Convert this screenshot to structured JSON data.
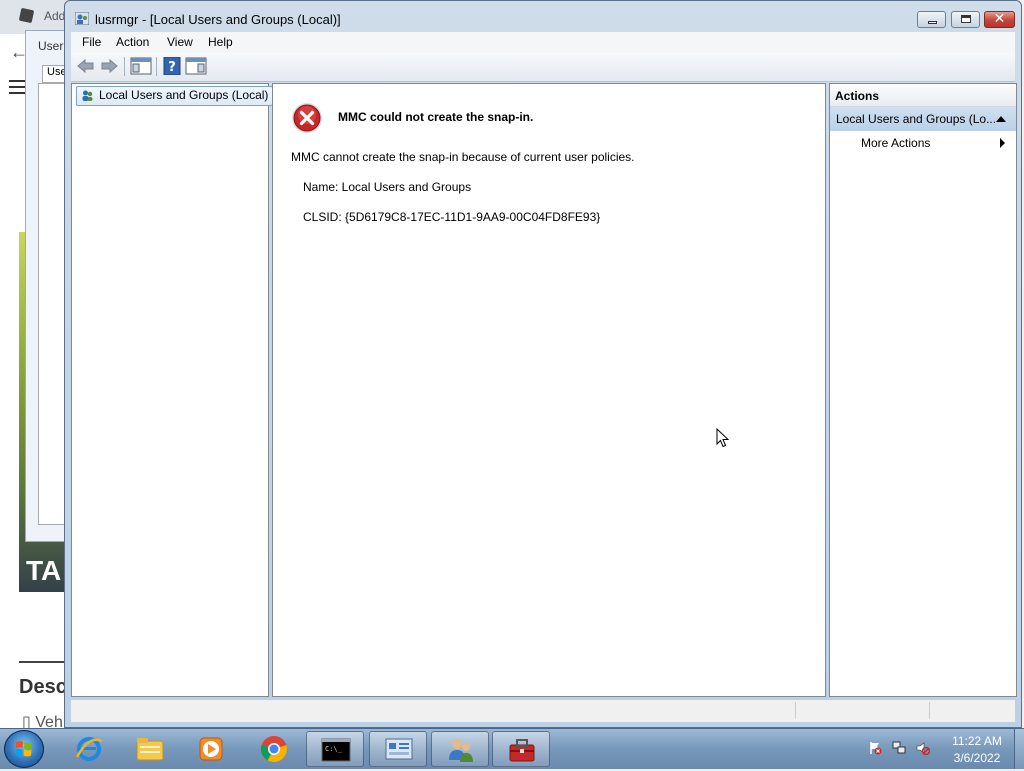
{
  "background": {
    "tab_title": "Add",
    "dialog_title": "User",
    "dialog_tab": "Use",
    "image_text": "TA",
    "heading": "Desc",
    "subtext": "▯ Veh"
  },
  "window": {
    "title": "lusrmgr - [Local Users and Groups (Local)]",
    "buttons": {
      "minimize": "minimize",
      "maximize": "restore",
      "close": "✕"
    }
  },
  "menu": [
    "File",
    "Action",
    "View",
    "Help"
  ],
  "toolbar": {
    "icons": [
      "back-arrow-icon",
      "forward-arrow-icon",
      "show-hide-console-tree-icon",
      "help-icon",
      "show-hide-action-pane-icon"
    ]
  },
  "tree": {
    "root_label": "Local Users and Groups (Local)"
  },
  "error": {
    "title": "MMC could not create the snap-in.",
    "message": "MMC cannot create the snap-in because of current user policies.",
    "name_line": "Name: Local Users and Groups",
    "clsid_line": "CLSID: {5D6179C8-17EC-11D1-9AA9-00C04FD8FE93}"
  },
  "actions": {
    "header": "Actions",
    "group_label": "Local Users and Groups (Lo...",
    "items": [
      "More Actions"
    ]
  },
  "taskbar": {
    "apps": [
      {
        "name": "internet-explorer-icon",
        "running": false
      },
      {
        "name": "windows-explorer-icon",
        "running": false
      },
      {
        "name": "media-player-icon",
        "running": false
      },
      {
        "name": "chrome-icon",
        "running": false
      },
      {
        "name": "command-prompt-icon",
        "running": true
      },
      {
        "name": "control-panel-icon",
        "running": true
      },
      {
        "name": "users-icon",
        "running": true
      },
      {
        "name": "toolbox-icon",
        "running": true
      }
    ],
    "clock_time": "11:22 AM",
    "clock_date": "3/6/2022"
  },
  "colors": {
    "error_red": "#c62828",
    "selection_blue": "#b9d0e8",
    "taskbar": "#7898ba"
  }
}
